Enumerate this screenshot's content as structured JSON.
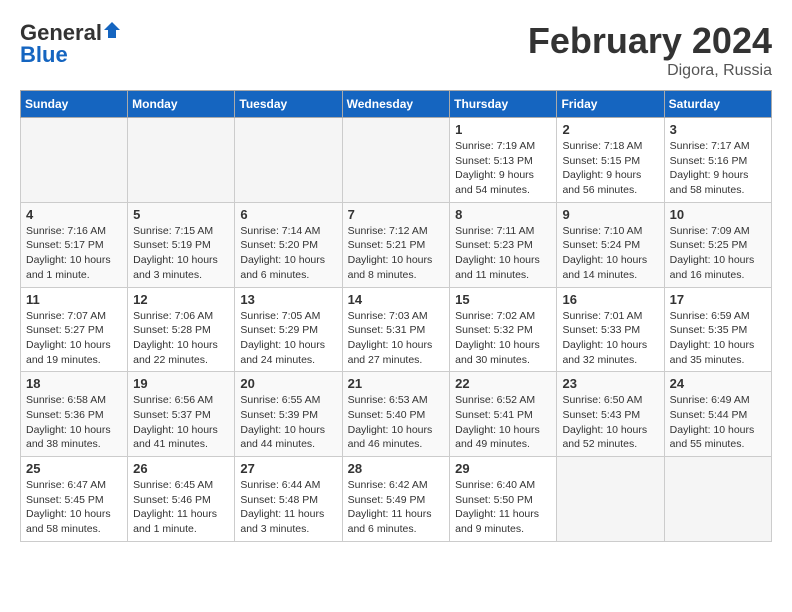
{
  "header": {
    "logo_general": "General",
    "logo_blue": "Blue",
    "main_title": "February 2024",
    "subtitle": "Digora, Russia"
  },
  "days_of_week": [
    "Sunday",
    "Monday",
    "Tuesday",
    "Wednesday",
    "Thursday",
    "Friday",
    "Saturday"
  ],
  "weeks": [
    [
      {
        "day": "",
        "info": ""
      },
      {
        "day": "",
        "info": ""
      },
      {
        "day": "",
        "info": ""
      },
      {
        "day": "",
        "info": ""
      },
      {
        "day": "1",
        "info": "Sunrise: 7:19 AM\nSunset: 5:13 PM\nDaylight: 9 hours\nand 54 minutes."
      },
      {
        "day": "2",
        "info": "Sunrise: 7:18 AM\nSunset: 5:15 PM\nDaylight: 9 hours\nand 56 minutes."
      },
      {
        "day": "3",
        "info": "Sunrise: 7:17 AM\nSunset: 5:16 PM\nDaylight: 9 hours\nand 58 minutes."
      }
    ],
    [
      {
        "day": "4",
        "info": "Sunrise: 7:16 AM\nSunset: 5:17 PM\nDaylight: 10 hours\nand 1 minute."
      },
      {
        "day": "5",
        "info": "Sunrise: 7:15 AM\nSunset: 5:19 PM\nDaylight: 10 hours\nand 3 minutes."
      },
      {
        "day": "6",
        "info": "Sunrise: 7:14 AM\nSunset: 5:20 PM\nDaylight: 10 hours\nand 6 minutes."
      },
      {
        "day": "7",
        "info": "Sunrise: 7:12 AM\nSunset: 5:21 PM\nDaylight: 10 hours\nand 8 minutes."
      },
      {
        "day": "8",
        "info": "Sunrise: 7:11 AM\nSunset: 5:23 PM\nDaylight: 10 hours\nand 11 minutes."
      },
      {
        "day": "9",
        "info": "Sunrise: 7:10 AM\nSunset: 5:24 PM\nDaylight: 10 hours\nand 14 minutes."
      },
      {
        "day": "10",
        "info": "Sunrise: 7:09 AM\nSunset: 5:25 PM\nDaylight: 10 hours\nand 16 minutes."
      }
    ],
    [
      {
        "day": "11",
        "info": "Sunrise: 7:07 AM\nSunset: 5:27 PM\nDaylight: 10 hours\nand 19 minutes."
      },
      {
        "day": "12",
        "info": "Sunrise: 7:06 AM\nSunset: 5:28 PM\nDaylight: 10 hours\nand 22 minutes."
      },
      {
        "day": "13",
        "info": "Sunrise: 7:05 AM\nSunset: 5:29 PM\nDaylight: 10 hours\nand 24 minutes."
      },
      {
        "day": "14",
        "info": "Sunrise: 7:03 AM\nSunset: 5:31 PM\nDaylight: 10 hours\nand 27 minutes."
      },
      {
        "day": "15",
        "info": "Sunrise: 7:02 AM\nSunset: 5:32 PM\nDaylight: 10 hours\nand 30 minutes."
      },
      {
        "day": "16",
        "info": "Sunrise: 7:01 AM\nSunset: 5:33 PM\nDaylight: 10 hours\nand 32 minutes."
      },
      {
        "day": "17",
        "info": "Sunrise: 6:59 AM\nSunset: 5:35 PM\nDaylight: 10 hours\nand 35 minutes."
      }
    ],
    [
      {
        "day": "18",
        "info": "Sunrise: 6:58 AM\nSunset: 5:36 PM\nDaylight: 10 hours\nand 38 minutes."
      },
      {
        "day": "19",
        "info": "Sunrise: 6:56 AM\nSunset: 5:37 PM\nDaylight: 10 hours\nand 41 minutes."
      },
      {
        "day": "20",
        "info": "Sunrise: 6:55 AM\nSunset: 5:39 PM\nDaylight: 10 hours\nand 44 minutes."
      },
      {
        "day": "21",
        "info": "Sunrise: 6:53 AM\nSunset: 5:40 PM\nDaylight: 10 hours\nand 46 minutes."
      },
      {
        "day": "22",
        "info": "Sunrise: 6:52 AM\nSunset: 5:41 PM\nDaylight: 10 hours\nand 49 minutes."
      },
      {
        "day": "23",
        "info": "Sunrise: 6:50 AM\nSunset: 5:43 PM\nDaylight: 10 hours\nand 52 minutes."
      },
      {
        "day": "24",
        "info": "Sunrise: 6:49 AM\nSunset: 5:44 PM\nDaylight: 10 hours\nand 55 minutes."
      }
    ],
    [
      {
        "day": "25",
        "info": "Sunrise: 6:47 AM\nSunset: 5:45 PM\nDaylight: 10 hours\nand 58 minutes."
      },
      {
        "day": "26",
        "info": "Sunrise: 6:45 AM\nSunset: 5:46 PM\nDaylight: 11 hours\nand 1 minute."
      },
      {
        "day": "27",
        "info": "Sunrise: 6:44 AM\nSunset: 5:48 PM\nDaylight: 11 hours\nand 3 minutes."
      },
      {
        "day": "28",
        "info": "Sunrise: 6:42 AM\nSunset: 5:49 PM\nDaylight: 11 hours\nand 6 minutes."
      },
      {
        "day": "29",
        "info": "Sunrise: 6:40 AM\nSunset: 5:50 PM\nDaylight: 11 hours\nand 9 minutes."
      },
      {
        "day": "",
        "info": ""
      },
      {
        "day": "",
        "info": ""
      }
    ]
  ]
}
